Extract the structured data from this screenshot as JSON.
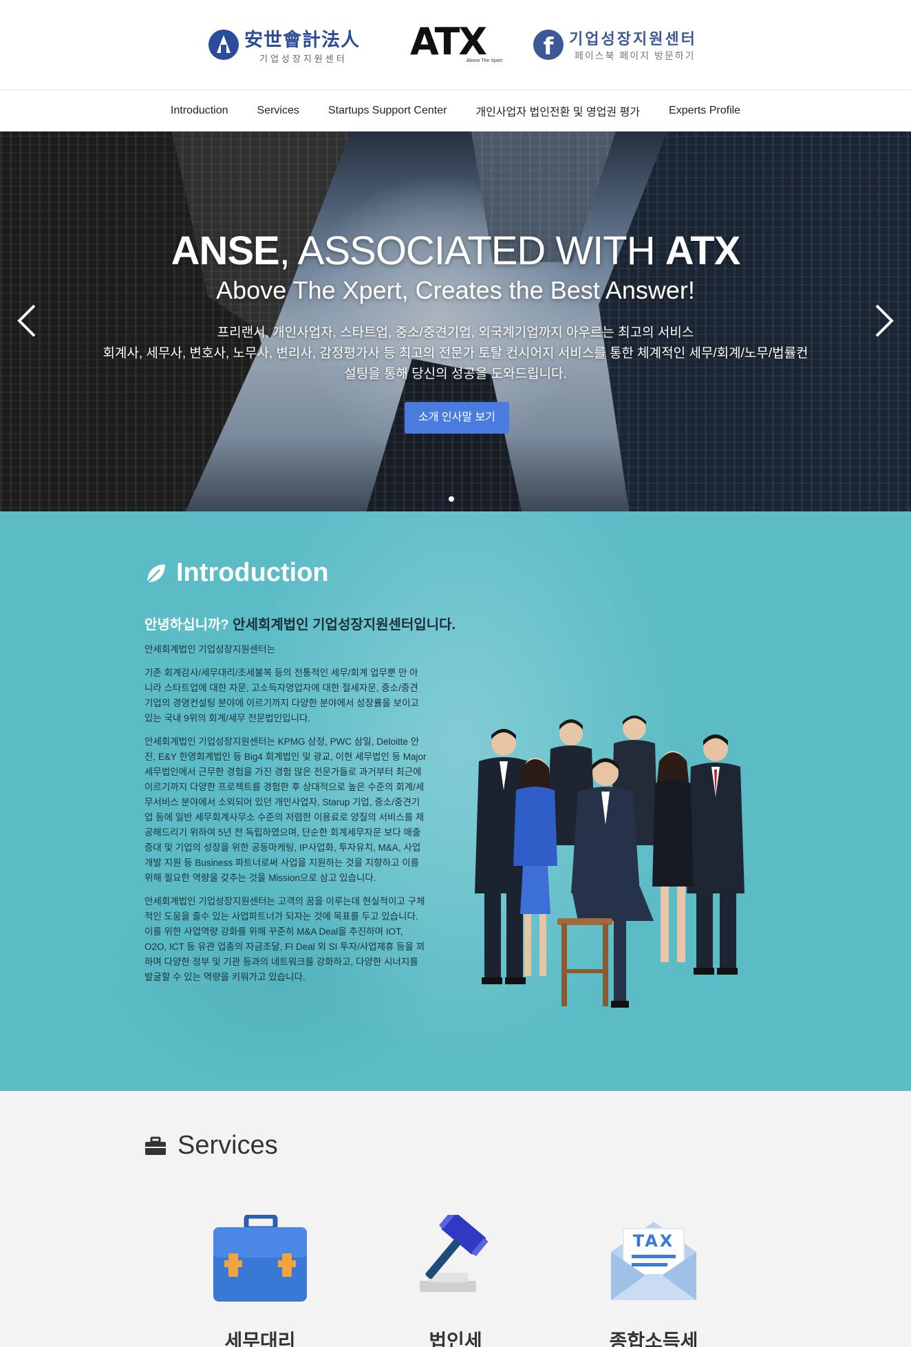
{
  "header": {
    "anse_logo": {
      "title": "安世會計法人",
      "subtitle": "기업성장지원센터"
    },
    "atx_logo": {
      "word": "ATX",
      "tagline": "Above The Xpert"
    },
    "facebook_link": {
      "title": "기업성장지원센터",
      "subtitle": "페이스북 페이지 방문하기"
    }
  },
  "nav": {
    "items": [
      "Introduction",
      "Services",
      "Startups Support Center",
      "개인사업자 법인전환 및 영업권 평가",
      "Experts Profile"
    ]
  },
  "hero": {
    "title_bold_1": "ANSE",
    "title_light": ", ASSOCIATED WITH ",
    "title_bold_2": "ATX",
    "subtitle": "Above The Xpert, Creates the Best Answer!",
    "desc_lines": [
      "프리랜서, 개인사업자, 스타트업, 중소/중견기업, 외국계기업까지 아우르는 최고의 서비스",
      "회계사, 세무사, 변호사, 노무사, 변리사, 감정평가사 등 최고의 전문가 토탈 컨시어지 서비스를 통한 체계적인 세무/회계/노무/법률컨",
      "설팅을 통해 당신의 성공을 도와드립니다."
    ],
    "button_label": "소개 인사말 보기",
    "active_slide": 1,
    "slide_count": 1
  },
  "intro": {
    "heading": "Introduction",
    "greeting_q": "안녕하십니까?",
    "greeting_s": " 안세회계법인 기업성장지원센터입니다.",
    "paragraphs": [
      "안세회계법인 기업성장지원센터는",
      "기존 회계감사/세무대리/조세불복 등의 전통적인 세무/회계 업무뿐 만 아니라 스타트업에 대한 자문, 고소득자영업자에 대한 절세자문, 중소/중견 기업의 경영컨설팅 분야에 이르기까지 다양한 분야에서 성장률을 보이고 있는 국내 9위의 회계/세무 전문법인입니다.",
      "안세회계법인 기업성장지원센터는 KPMG 삼정, PWC 삼일, Deloitte 안진, E&Y 한영회계법인 등 Big4 회계법인 및 광교, 이현 세무법인 등 Major 세무법인에서 근무한 경험을 가진 경험 많은 전문가들로 과거부터 최근에 이르기까지 다양한 프로젝트를 경험한 후 상대적으로 높은 수준의 회계/세무서비스 분야에서 소외되어 있던 개인사업자, Starup 기업, 중소/중견기업 등에 일반 세무회계사무소 수준의 저렴한 이용료로 양질의 서비스를 제공해드리기 위하여 5년 전 독립하였으며, 단순한 회계세무자문 보다 매출증대 및 기업의 성장을 위한 공동마케팅, IP사업화, 투자유치, M&A, 사업개발 지원 등 Business 파트너로써 사업을 지원하는 것을 지향하고 이를 위해 필요한 역량을 갖추는 것을 Mission으로 삼고 있습니다.",
      "안세회계법인 기업성장지원센터는 고객의 꿈을 이루는데 현실적이고 구체적인 도움을 줄수 있는 사업파트너가 되자는 것에 목표를 두고 있습니다. 이를 위한 사업역량 강화를 위해 꾸준히 M&A Deal을 추진하며 IOT, O2O, ICT 등 유관 업종의 자금조달, FI Deal 외 SI 투자/사업제휴 등을 꾀하며 다양한 정부 및 기관 등과의 네트워크를 강화하고, 다양한 시너지를 발굴할 수 있는 역량을 키워가고 있습니다."
    ]
  },
  "services": {
    "heading": "Services",
    "items": [
      {
        "label": "세무대리",
        "icon": "briefcase-icon"
      },
      {
        "label": "법인세",
        "icon": "gavel-icon"
      },
      {
        "label": "종합소득세",
        "icon": "tax-envelope-icon",
        "icon_text": "TAX"
      }
    ]
  },
  "colors": {
    "accent_button": "#4a7ce0",
    "intro_background": "#5bbcc6",
    "services_background": "#f3f3f3",
    "anse_blue": "#2b4c9b",
    "facebook_blue": "#3b5998"
  }
}
